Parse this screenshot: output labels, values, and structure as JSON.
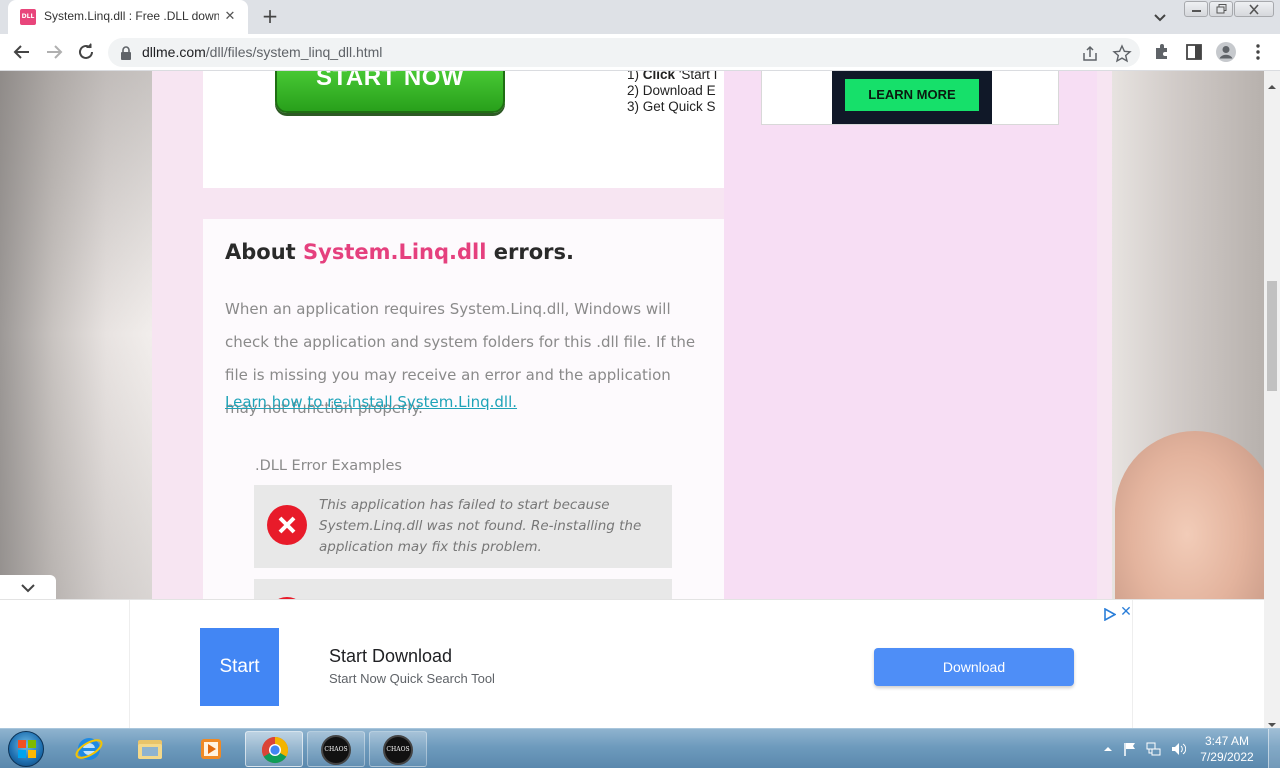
{
  "browser": {
    "tab_title": "System.Linq.dll : Free .DLL downl",
    "favicon_text": "DLL",
    "url_host": "dllme.com",
    "url_path": "/dll/files/system_linq_dll.html"
  },
  "page": {
    "top_ad": {
      "start_now": "START NOW",
      "steps": [
        {
          "num": "1)",
          "bold": "Click",
          "text": " 'Start I"
        },
        {
          "num": "2)",
          "bold": "",
          "text": "Download E"
        },
        {
          "num": "3)",
          "bold": "",
          "text": "Get Quick S"
        }
      ]
    },
    "side_ad": {
      "learn_more": "LEARN MORE"
    },
    "about": {
      "heading_pre": "About ",
      "heading_dll": "System.Linq.dll",
      "heading_post": " errors.",
      "paragraph": "When an application requires System.Linq.dll, Windows will check the application and system folders for this .dll file. If the file is missing you may receive an error and the application may not function properly.",
      "link": "Learn how to re-install System.Linq.dll."
    },
    "examples": {
      "label": ".DLL Error Examples",
      "items": [
        "This application has failed to start because System.Linq.dll was not found. Re-installing the application may fix this problem."
      ]
    }
  },
  "bottom_ad": {
    "logo_text": "Start",
    "title": "Start Download",
    "subtitle": "Start Now Quick Search Tool",
    "button": "Download"
  },
  "taskbar": {
    "time": "3:47 AM",
    "date": "7/29/2022",
    "chaos_label": "CHAOS"
  },
  "colors": {
    "accent_pink": "#e5407e",
    "link_teal": "#1fa3b8",
    "ad_blue": "#4e8ef7",
    "learn_green": "#16e06a"
  }
}
